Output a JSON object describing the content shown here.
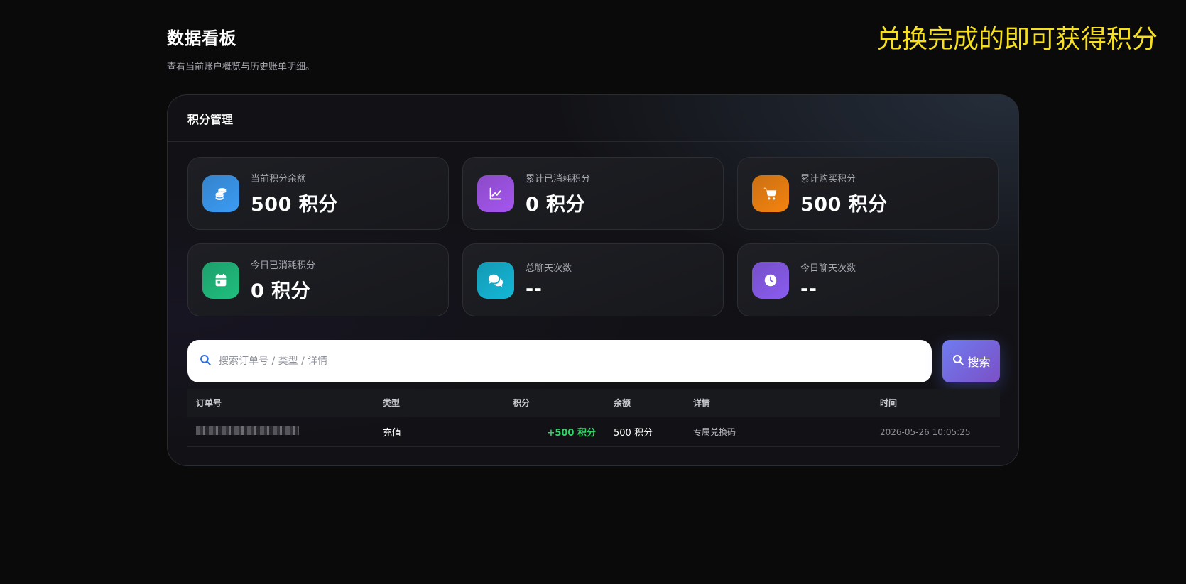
{
  "header": {
    "title": "数据看板",
    "subtitle": "查看当前账户概览与历史账单明细。"
  },
  "banner": "兑换完成的即可获得积分",
  "panel": {
    "title": "积分管理"
  },
  "stats": [
    {
      "label": "当前积分余额",
      "value": "500 积分",
      "icon": "coins-icon",
      "color": "#3b9cf5"
    },
    {
      "label": "累计已消耗积分",
      "value": "0 积分",
      "icon": "chart-line-icon",
      "color": "#a656f0"
    },
    {
      "label": "累计购买积分",
      "value": "500 积分",
      "icon": "cart-icon",
      "color": "#f5840f"
    },
    {
      "label": "今日已消耗积分",
      "value": "0 积分",
      "icon": "calendar-icon",
      "color": "#1fbf7e"
    },
    {
      "label": "总聊天次数",
      "value": "--",
      "icon": "chat-bubbles-icon",
      "color": "#13b8d8"
    },
    {
      "label": "今日聊天次数",
      "value": "--",
      "icon": "clock-icon",
      "color": "#8b5cf0"
    }
  ],
  "search": {
    "placeholder": "搜索订单号 / 类型 / 详情",
    "button_label": "搜索"
  },
  "table": {
    "columns": [
      "订单号",
      "类型",
      "积分",
      "余额",
      "详情",
      "时间"
    ],
    "rows": [
      {
        "type": "充值",
        "points": "+500 积分",
        "balance": "500 积分",
        "detail": "专属兑换码",
        "time": "2026-05-26 10:05:25"
      }
    ]
  }
}
